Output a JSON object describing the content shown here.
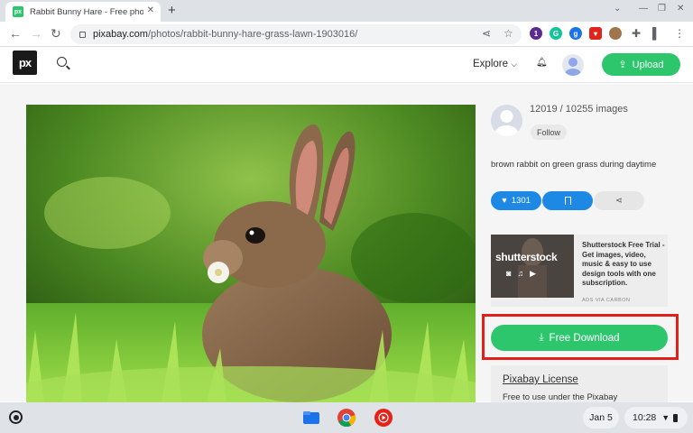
{
  "browser": {
    "tab_title": "Rabbit Bunny Hare - Free photo on Pixabay",
    "tab_favicon_text": "px",
    "url_host": "pixabay.com",
    "url_path": "/photos/rabbit-bunny-hare-grass-lawn-1903016/",
    "extensions": [
      {
        "icon": "privacy-extension-icon",
        "color": "#5b2c8f",
        "label": "1"
      },
      {
        "icon": "grammarly-icon",
        "color": "#15c39a",
        "label": "G"
      },
      {
        "icon": "extension-g-icon",
        "color": "#1a73e8",
        "label": "g"
      },
      {
        "icon": "shield-extension-icon",
        "color": "#e2231a",
        "label": "▾"
      },
      {
        "icon": "cookie-extension-icon",
        "color": "#a0754d",
        "label": "●"
      }
    ]
  },
  "header": {
    "logo_text": "px",
    "explore_label": "Explore",
    "upload_label": "Upload"
  },
  "sidebar": {
    "stats": "12019 / 10255 images",
    "follow_label": "Follow",
    "description": "brown rabbit on green grass during daytime",
    "like_count": "1301",
    "ad": {
      "brand": "shutterstock",
      "text": "Shutterstock Free Trial - Get images, video, music & easy to use design tools with one subscription.",
      "via": "ADS VIA CARBON"
    },
    "download_label": "Free Download",
    "license_title": "Pixabay License",
    "license_text": "Free to use under the Pixabay"
  },
  "colors": {
    "brand_green": "#2ec66d",
    "action_blue": "#1e88e5",
    "highlight_red": "#e0211b"
  },
  "shelf": {
    "date": "Jan 5",
    "time": "10:28"
  }
}
